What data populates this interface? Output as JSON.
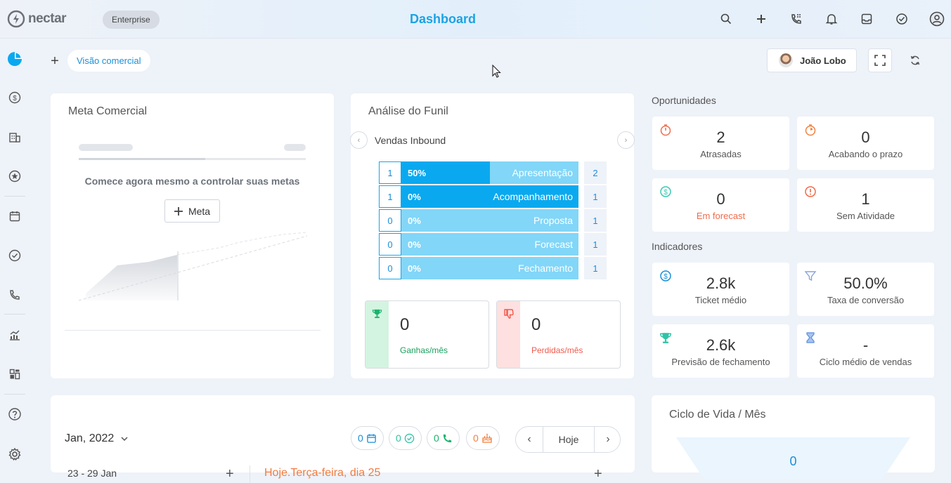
{
  "header": {
    "logo_text": "nectar",
    "plan_badge": "Enterprise",
    "title": "Dashboard",
    "icons": [
      "search-icon",
      "plus-icon",
      "phone-dialpad-icon",
      "bell-icon",
      "inbox-icon",
      "check-circle-icon",
      "user-circle-icon"
    ]
  },
  "sidebar": {
    "icons": [
      "dashboard-pie-icon",
      "dollar-icon",
      "building-icon",
      "star-icon",
      "calendar-icon",
      "check-circle-icon",
      "phone-icon",
      "analytics-icon",
      "widgets-icon",
      "help-icon",
      "gear-icon"
    ]
  },
  "toolbar": {
    "add_label": "+",
    "view_tab": "Visão comercial",
    "user_name": "João Lobo"
  },
  "meta_comercial": {
    "title": "Meta Comercial",
    "empty_message": "Comece agora mesmo a controlar suas metas",
    "button_label": "Meta"
  },
  "funil": {
    "title": "Análise do Funil",
    "pipeline": "Vendas Inbound",
    "stages": [
      {
        "count": "1",
        "percent": "50%",
        "fill": 0.5,
        "label": "Apresentação",
        "total": "2"
      },
      {
        "count": "1",
        "percent": "0%",
        "fill": 1.0,
        "label": "Acompanhamento",
        "total": "1"
      },
      {
        "count": "0",
        "percent": "0%",
        "fill": 0,
        "label": "Proposta",
        "total": "1"
      },
      {
        "count": "0",
        "percent": "0%",
        "fill": 0,
        "label": "Forecast",
        "total": "1"
      },
      {
        "count": "0",
        "percent": "0%",
        "fill": 0,
        "label": "Fechamento",
        "total": "1"
      }
    ],
    "won": {
      "value": "0",
      "label": "Ganhas/mês"
    },
    "lost": {
      "value": "0",
      "label": "Perdidas/mês"
    }
  },
  "oportunidades": {
    "title": "Oportunidades",
    "items": [
      {
        "value": "2",
        "label": "Atrasadas",
        "icon": "stopwatch-icon",
        "color": "#f26b4a"
      },
      {
        "value": "0",
        "label": "Acabando o prazo",
        "icon": "timer-icon",
        "color": "#f0813f"
      },
      {
        "value": "0",
        "label": "Em forecast",
        "icon": "dollar-icon",
        "color": "#3cc9b4"
      },
      {
        "value": "1",
        "label": "Sem Atividade",
        "icon": "alert-icon",
        "color": "#f26b4a"
      }
    ]
  },
  "indicadores": {
    "title": "Indicadores",
    "items": [
      {
        "value": "2.8k",
        "label": "Ticket médio",
        "icon": "dollar-icon",
        "color": "#1a8fd9"
      },
      {
        "value": "50.0%",
        "label": "Taxa de conversão",
        "icon": "funnel-icon",
        "color": "#8aa3d9"
      },
      {
        "value": "2.6k",
        "label": "Previsão de fechamento",
        "icon": "trophy-icon",
        "color": "#2fc3a6"
      },
      {
        "value": "-",
        "label": "Ciclo médio de vendas",
        "icon": "hourglass-icon",
        "color": "#5b8fe0"
      }
    ]
  },
  "calendar": {
    "month": "Jan, 2022",
    "chips": [
      {
        "value": "0",
        "icon": "calendar-icon",
        "color": "#1a8fd9"
      },
      {
        "value": "0",
        "icon": "check-circle-icon",
        "color": "#2fc3a6"
      },
      {
        "value": "0",
        "icon": "phone-icon",
        "color": "#19b36b"
      },
      {
        "value": "0",
        "icon": "cake-icon",
        "color": "#f0813f"
      }
    ],
    "today_button": "Hoje",
    "week_range": "23 - 29 Jan",
    "today_label": "Hoje.Terça-feira, dia 25"
  },
  "ciclo_vida": {
    "title": "Ciclo de Vida / Mês",
    "value": "0"
  }
}
